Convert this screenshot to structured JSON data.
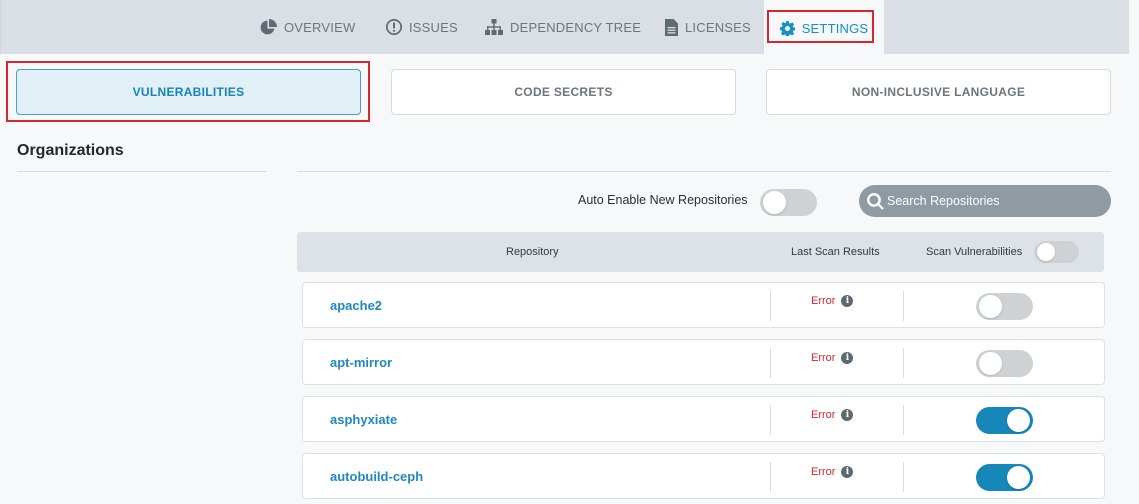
{
  "tabs": [
    {
      "label": "OVERVIEW",
      "icon": "pie-chart-icon"
    },
    {
      "label": "ISSUES",
      "icon": "exclamation-circle-icon"
    },
    {
      "label": "DEPENDENCY TREE",
      "icon": "sitemap-icon"
    },
    {
      "label": "LICENSES",
      "icon": "document-icon"
    },
    {
      "label": "SETTINGS",
      "icon": "gear-icon",
      "active": true
    }
  ],
  "scan_types": [
    {
      "label": "VULNERABILITIES",
      "active": true
    },
    {
      "label": "CODE SECRETS",
      "active": false
    },
    {
      "label": "NON-INCLUSIVE LANGUAGE",
      "active": false
    }
  ],
  "organizations_title": "Organizations",
  "auto_enable": {
    "label": "Auto Enable New Repositories",
    "on": false
  },
  "search": {
    "placeholder": "Search Repositories"
  },
  "table": {
    "headers": {
      "repository": "Repository",
      "last_scan": "Last Scan Results",
      "scan_vuln": "Scan Vulnerabilities"
    },
    "scan_all_on": false,
    "rows": [
      {
        "name": "apache2",
        "result": "Error",
        "scan_on": false
      },
      {
        "name": "apt-mirror",
        "result": "Error",
        "scan_on": false
      },
      {
        "name": "asphyxiate",
        "result": "Error",
        "scan_on": true
      },
      {
        "name": "autobuild-ceph",
        "result": "Error",
        "scan_on": true
      }
    ]
  },
  "colors": {
    "accent": "#1591c3",
    "error": "#d3272d",
    "highlight": "#d7262c"
  }
}
